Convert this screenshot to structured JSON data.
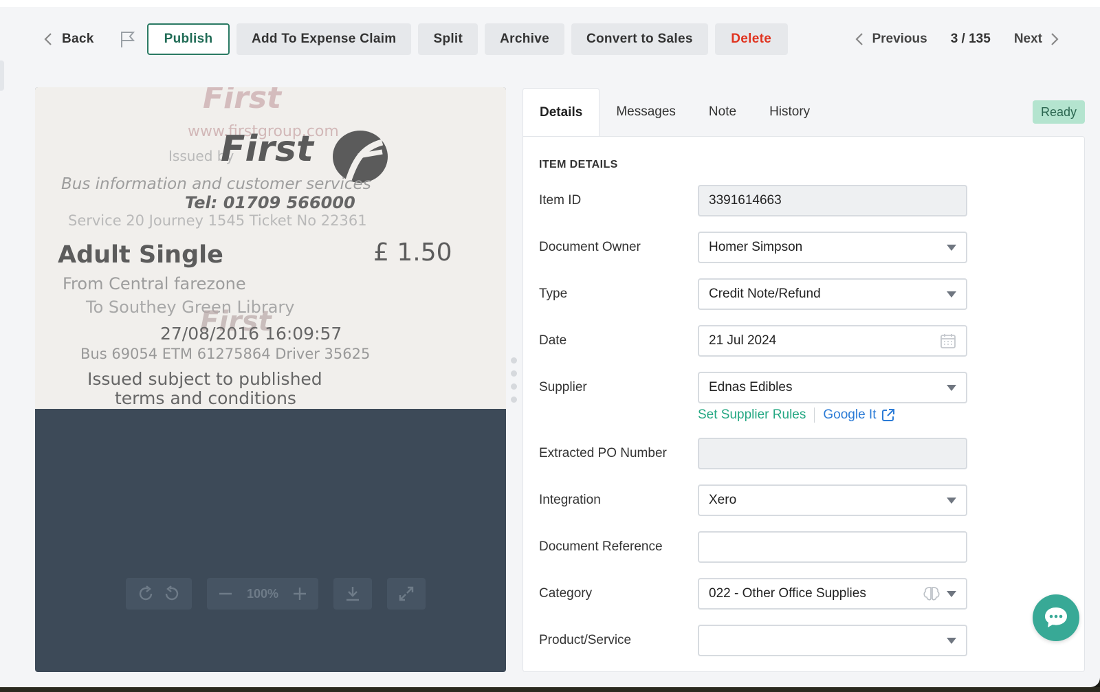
{
  "toolbar": {
    "back_label": "Back",
    "publish_label": "Publish",
    "expense_label": "Add To Expense Claim",
    "split_label": "Split",
    "archive_label": "Archive",
    "convert_label": "Convert to Sales",
    "delete_label": "Delete"
  },
  "pager": {
    "previous_label": "Previous",
    "count": "3 / 135",
    "next_label": "Next"
  },
  "receipt": {
    "logo_top": "First",
    "website": "www.firstgroup.com",
    "issued_by": "Issued by",
    "logo": "First",
    "info_line": "Bus information and customer services",
    "tel": "Tel: 01709 566000",
    "service": "Service   20     Journey   1545     Ticket No  22361",
    "ticket_type": "Adult Single",
    "price": "£ 1.50",
    "from": "From  Central farezone",
    "to": "To  Southey Green Library",
    "logo_mid": "First",
    "datetime": "27/08/2016    16:09:57",
    "bus": "Bus  69054      ETM  61275864     Driver  35625",
    "issued_subject": "Issued subject to published",
    "terms": "terms and conditions"
  },
  "viewer": {
    "zoom": "100%"
  },
  "tabs": {
    "details": "Details",
    "messages": "Messages",
    "note": "Note",
    "history": "History"
  },
  "status": "Ready",
  "details": {
    "section_title": "ITEM DETAILS",
    "item_id_label": "Item ID",
    "item_id": "3391614663",
    "owner_label": "Document Owner",
    "owner": "Homer Simpson",
    "type_label": "Type",
    "type": "Credit Note/Refund",
    "date_label": "Date",
    "date": "21 Jul 2024",
    "supplier_label": "Supplier",
    "supplier": "Ednas Edibles",
    "supplier_rules_link": "Set Supplier Rules",
    "google_link": "Google It",
    "po_label": "Extracted PO Number",
    "po": "",
    "integration_label": "Integration",
    "integration": "Xero",
    "reference_label": "Document Reference",
    "reference": "",
    "category_label": "Category",
    "category": "022 - Other Office Supplies",
    "product_label": "Product/Service",
    "product": ""
  },
  "colors": {
    "accent_green": "#2a7a63",
    "link_green": "#25a883",
    "link_blue": "#2b7bd6",
    "delete_red": "#e0331f",
    "ready_bg": "#b4e4cf",
    "chat_bg": "#38a996",
    "preview_bg": "#3d4a58"
  }
}
